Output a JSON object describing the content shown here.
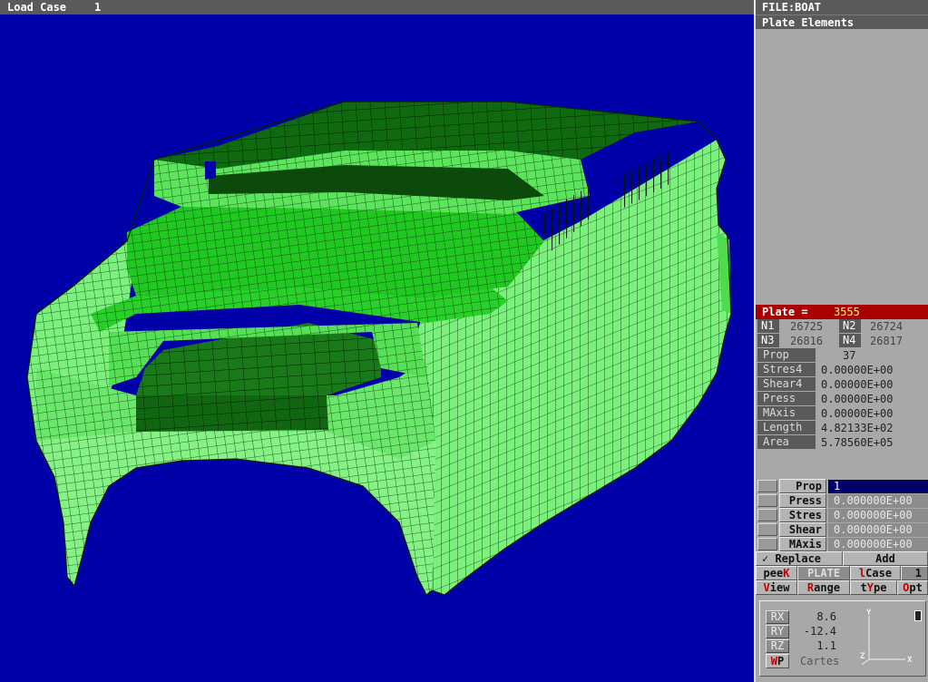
{
  "topbar": {
    "load_case_label": "Load Case",
    "load_case_value": "1"
  },
  "panel": {
    "file": "FILE:BOAT",
    "title": "Plate Elements",
    "plate": {
      "label": "Plate =",
      "value": "3555"
    },
    "nodes": [
      {
        "label": "N1",
        "value": "26725"
      },
      {
        "label": "N2",
        "value": "26724"
      },
      {
        "label": "N3",
        "value": "26816"
      },
      {
        "label": "N4",
        "value": "26817"
      }
    ],
    "info": [
      {
        "label": "Prop",
        "value": "37"
      },
      {
        "label": "Stres4",
        "value": "0.00000E+00"
      },
      {
        "label": "Shear4",
        "value": "0.00000E+00"
      },
      {
        "label": "Press",
        "value": "0.00000E+00"
      },
      {
        "label": "MAxis",
        "value": "0.00000E+00"
      },
      {
        "label": "Length",
        "value": "4.82133E+02"
      },
      {
        "label": "Area",
        "value": "5.78560E+05"
      }
    ],
    "fields": [
      {
        "label": "Prop",
        "value": "1"
      },
      {
        "label": "Press",
        "value": "0.000000E+00"
      },
      {
        "label": "Stres",
        "value": "0.000000E+00"
      },
      {
        "label": "Shear",
        "value": "0.000000E+00"
      },
      {
        "label": "MAxis",
        "value": "0.000000E+00"
      }
    ],
    "replace_label": "✓ Replace",
    "add_label": "Add",
    "menu": {
      "peek_pre": "pee",
      "peek_key": "K",
      "plate": "PLATE",
      "lcase_key": "l",
      "lcase_post": "Case",
      "lcase_value": "1",
      "view_key": "V",
      "view_post": "iew",
      "range_key": "R",
      "range_post": "ange",
      "type_pre": "t",
      "type_key": "Y",
      "type_post": "pe",
      "opt_key": "O",
      "opt_post": "pt"
    },
    "coords": {
      "rx_label": "RX",
      "rx": "8.6",
      "ry_label": "RY",
      "ry": "-12.4",
      "rz_label": "RZ",
      "rz": "1.1",
      "wp_key": "W",
      "wp_post": "P",
      "system": "Cartes",
      "axis_x": "X",
      "axis_y": "Y",
      "axis_z": "Z"
    }
  },
  "colors": {
    "background": "#0000a8",
    "mesh_light": "#7cf07c",
    "mesh_mid": "#33dd33",
    "mesh_dark": "#118811",
    "mesh_lines": "#003300",
    "highlight": "#a80000"
  }
}
